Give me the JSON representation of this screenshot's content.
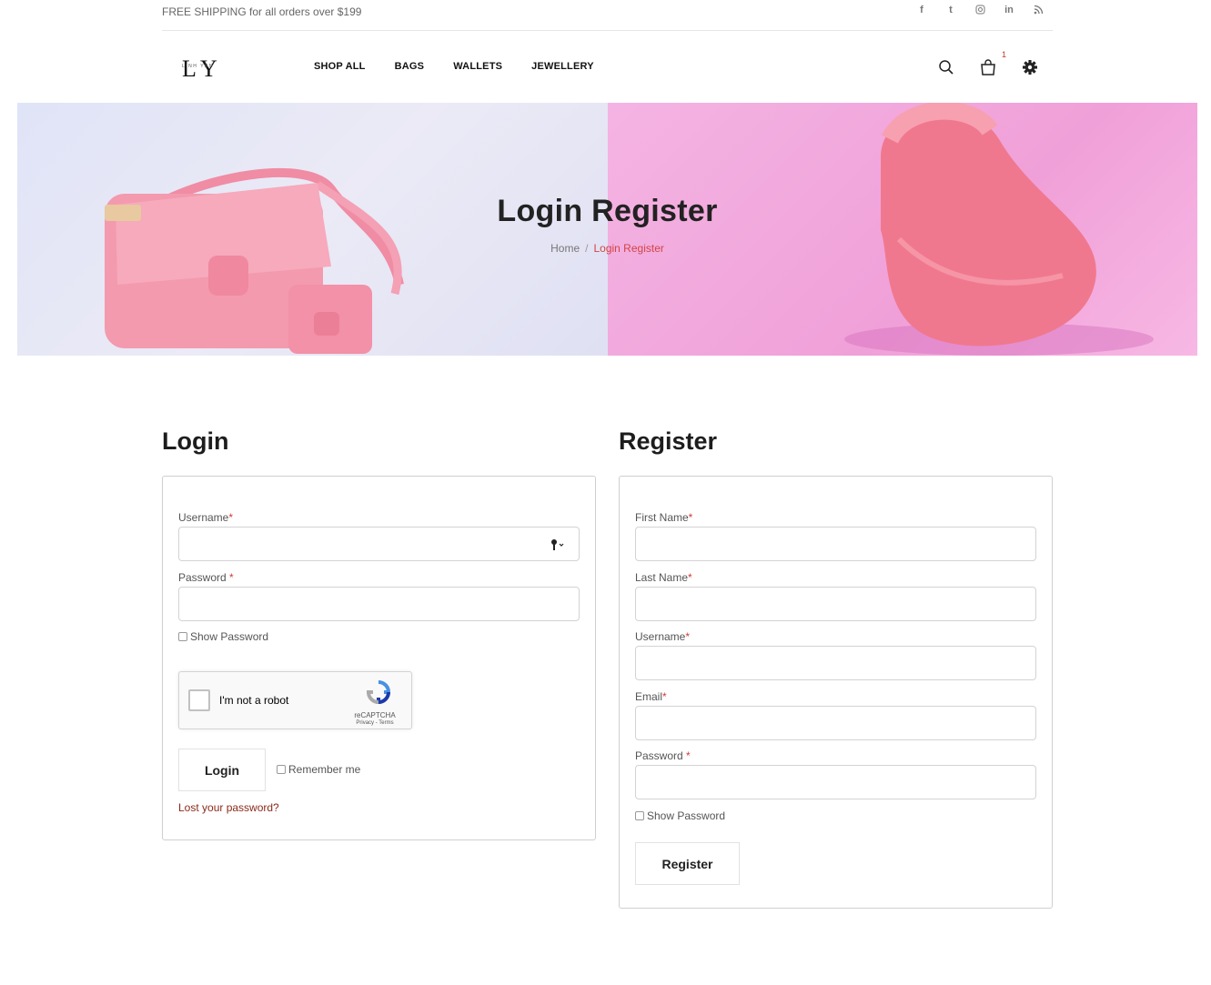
{
  "topbar": {
    "shipping_text": "FREE SHIPPING for all orders over $199",
    "social": [
      "f",
      "t",
      "o",
      "in",
      "rss"
    ]
  },
  "header": {
    "logo_alt": "LINH YEN",
    "nav": [
      "SHOP ALL",
      "BAGS",
      "WALLETS",
      "JEWELLERY"
    ],
    "cart_count": "1"
  },
  "hero": {
    "title": "Login Register",
    "breadcrumb_home": "Home",
    "breadcrumb_sep": "/",
    "breadcrumb_current": "Login Register"
  },
  "login": {
    "title": "Login",
    "username_label": "Username",
    "password_label": "Password ",
    "required_mark": "*",
    "show_password": "Show Password",
    "captcha_text": "I'm not a robot",
    "captcha_brand": "reCAPTCHA",
    "captcha_terms": "Privacy - Terms",
    "login_button": "Login",
    "remember_me": "Remember me",
    "lost_password": "Lost your password?"
  },
  "register": {
    "title": "Register",
    "first_name_label": "First Name",
    "last_name_label": "Last Name",
    "username_label": "Username",
    "email_label": "Email",
    "password_label": "Password ",
    "required_mark": "*",
    "show_password": "Show Password",
    "register_button": "Register"
  },
  "colors": {
    "accent_red": "#d14545",
    "required_red": "#d23a3a",
    "link_brown": "#8b2a1a"
  }
}
